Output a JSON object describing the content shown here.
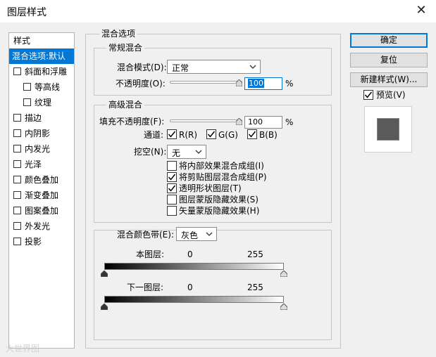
{
  "window": {
    "title": "图层样式"
  },
  "sidebar": {
    "header": "样式",
    "items": [
      {
        "label": "混合选项:默认",
        "active": true,
        "checkbox": false,
        "checked": false,
        "indent": 0
      },
      {
        "label": "斜面和浮雕",
        "checkbox": true,
        "checked": false,
        "indent": 0
      },
      {
        "label": "等高线",
        "checkbox": true,
        "checked": false,
        "indent": 1
      },
      {
        "label": "纹理",
        "checkbox": true,
        "checked": false,
        "indent": 1
      },
      {
        "label": "描边",
        "checkbox": true,
        "checked": false,
        "indent": 0
      },
      {
        "label": "内阴影",
        "checkbox": true,
        "checked": false,
        "indent": 0
      },
      {
        "label": "内发光",
        "checkbox": true,
        "checked": false,
        "indent": 0
      },
      {
        "label": "光泽",
        "checkbox": true,
        "checked": false,
        "indent": 0
      },
      {
        "label": "颜色叠加",
        "checkbox": true,
        "checked": false,
        "indent": 0
      },
      {
        "label": "渐变叠加",
        "checkbox": true,
        "checked": false,
        "indent": 0
      },
      {
        "label": "图案叠加",
        "checkbox": true,
        "checked": false,
        "indent": 0
      },
      {
        "label": "外发光",
        "checkbox": true,
        "checked": false,
        "indent": 0
      },
      {
        "label": "投影",
        "checkbox": true,
        "checked": false,
        "indent": 0
      }
    ]
  },
  "blend_options": {
    "title": "混合选项",
    "general": {
      "title": "常规混合",
      "mode_label": "混合模式(D):",
      "mode_value": "正常",
      "opacity_label": "不透明度(O):",
      "opacity_value": "100",
      "opacity_unit": "%",
      "opacity_level": 1.0
    },
    "advanced": {
      "title": "高级混合",
      "fill_opacity_label": "填充不透明度(F):",
      "fill_opacity_value": "100",
      "fill_opacity_unit": "%",
      "fill_opacity_level": 1.0,
      "channels_label": "通道:",
      "channels": [
        {
          "label": "R(R)",
          "checked": true
        },
        {
          "label": "G(G)",
          "checked": true
        },
        {
          "label": "B(B)",
          "checked": true
        }
      ],
      "knockout_label": "挖空(N):",
      "knockout_value": "无",
      "options": [
        {
          "label": "将内部效果混合成组(I)",
          "checked": false
        },
        {
          "label": "将剪贴图层混合成组(P)",
          "checked": true
        },
        {
          "label": "透明形状图层(T)",
          "checked": true
        },
        {
          "label": "图层蒙版隐藏效果(S)",
          "checked": false
        },
        {
          "label": "矢量蒙版隐藏效果(H)",
          "checked": false
        }
      ]
    },
    "blend_if": {
      "label": "混合颜色带(E):",
      "value": "灰色",
      "this_layer": {
        "label": "本图层:",
        "min": "0",
        "max": "255"
      },
      "underlying_layer": {
        "label": "下一图层:",
        "min": "0",
        "max": "255"
      }
    }
  },
  "buttons": {
    "ok": "确定",
    "reset": "复位",
    "new_style": "新建样式(W)..."
  },
  "preview": {
    "label": "预览(V)",
    "checked": true
  },
  "watermark": "大世界图",
  "colors": {
    "accent": "#0078d7",
    "preview_swatch": "#5a5a5a"
  }
}
